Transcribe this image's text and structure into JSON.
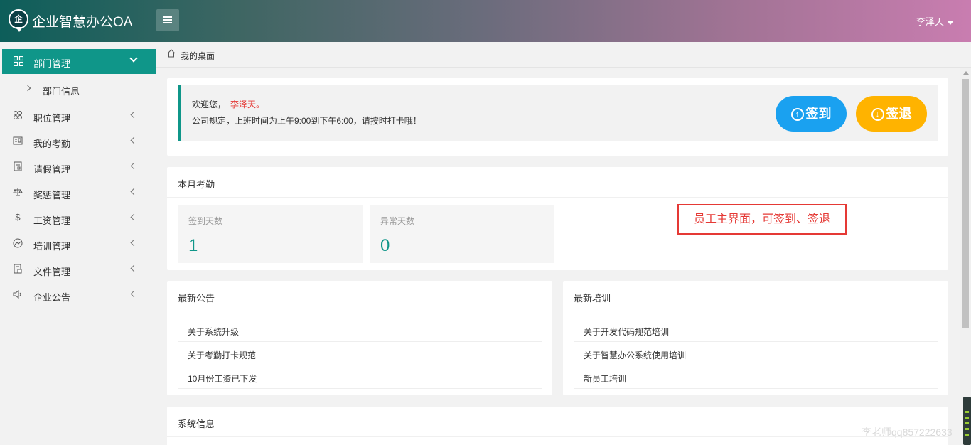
{
  "header": {
    "logo_text": "企",
    "app_title": "企业智慧办公OA",
    "user_name": "李泽天"
  },
  "sidebar": {
    "active": {
      "label": "部门管理",
      "icon": "grid-icon"
    },
    "sub_items": [
      {
        "label": "部门信息"
      }
    ],
    "items": [
      {
        "label": "职位管理",
        "icon": "users-icon"
      },
      {
        "label": "我的考勤",
        "icon": "calendar-icon"
      },
      {
        "label": "请假管理",
        "icon": "note-icon"
      },
      {
        "label": "奖惩管理",
        "icon": "scale-icon"
      },
      {
        "label": "工资管理",
        "icon": "dollar-icon"
      },
      {
        "label": "培训管理",
        "icon": "chart-icon"
      },
      {
        "label": "文件管理",
        "icon": "file-icon"
      },
      {
        "label": "企业公告",
        "icon": "speaker-icon"
      }
    ]
  },
  "breadcrumb": {
    "label": "我的桌面"
  },
  "welcome": {
    "greeting": "欢迎您，",
    "name": "李泽天。",
    "rule": "公司规定，上班时间为上午9:00到下午6:00，请按时打卡哦！",
    "checkin_label": "签到",
    "checkout_label": "签退"
  },
  "attendance": {
    "title": "本月考勤",
    "signin_label": "签到天数",
    "signin_value": "1",
    "abnormal_label": "异常天数",
    "abnormal_value": "0"
  },
  "annotation": "员工主界面，可签到、签退",
  "announcements": {
    "title": "最新公告",
    "items": [
      "关于系统升级",
      "关于考勤打卡规范",
      "10月份工资已下发"
    ]
  },
  "trainings": {
    "title": "最新培训",
    "items": [
      "关于开发代码规范培训",
      "关于智慧办公系统使用培训",
      "新员工培训"
    ]
  },
  "system_info": {
    "title": "系统信息"
  },
  "watermark": "李老师qq857222633",
  "colors": {
    "accent": "#0f9689",
    "checkin": "#1aa1f0",
    "checkout": "#ffb300",
    "highlight": "#e53935"
  }
}
